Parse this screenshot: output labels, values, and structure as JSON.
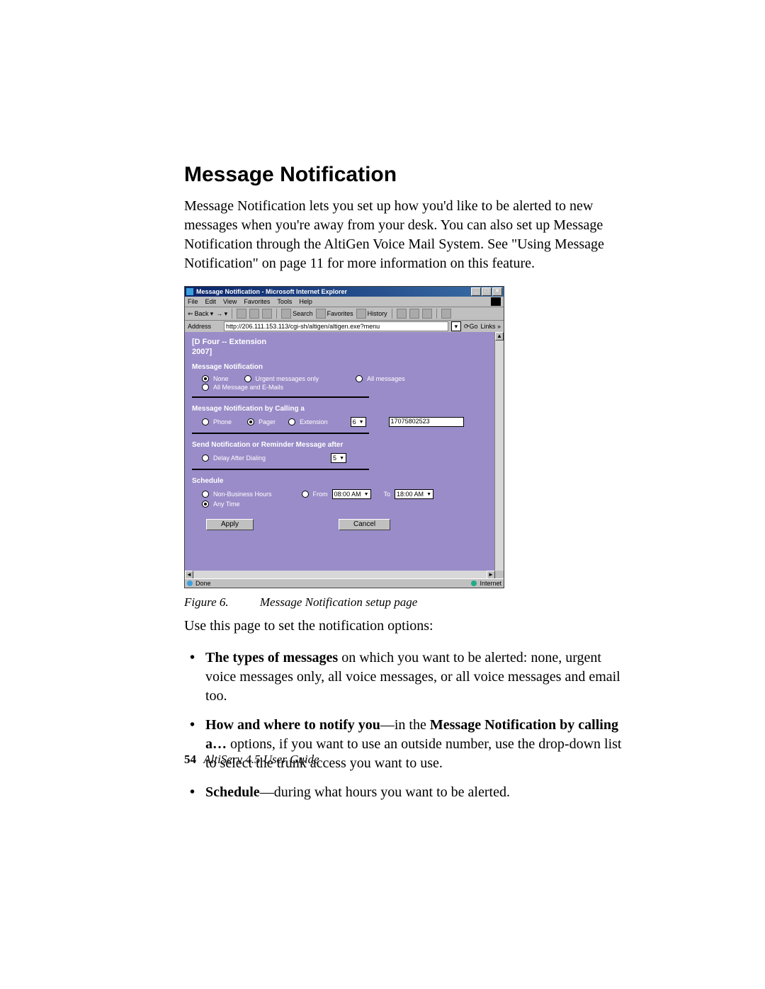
{
  "heading": "Message Notification",
  "intro": "Message Notification lets you set up how you'd like to be alerted to new messages when you're away from your desk. You can also set up Message Notification through the AltiGen Voice Mail System. See \"Using Message Notification\" on page 11 for more information on this feature.",
  "caption": {
    "label": "Figure 6.",
    "text": "Message Notification setup page"
  },
  "lead_out": "Use this page to set the notification options:",
  "bullets": [
    {
      "b": "The types of messages",
      "rest": " on which you want to be alerted: none, urgent voice messages only, all voice messages, or all voice messages and email too."
    },
    {
      "b": "How and where to notify you",
      "mid": "—in the ",
      "b2": "Message Notification by calling a…",
      "rest": " options, if you want to use an outside number, use the drop-down list to select the trunk access you want to use."
    },
    {
      "b": "Schedule",
      "rest": "—during what hours you want to be alerted."
    }
  ],
  "footer": {
    "page": "54",
    "guide": "AltiServ 4.5 User Guide"
  },
  "ie": {
    "title": "Message Notification - Microsoft Internet Explorer",
    "menus": [
      "File",
      "Edit",
      "View",
      "Favorites",
      "Tools",
      "Help"
    ],
    "toolbar": {
      "back": "Back",
      "search": "Search",
      "favorites": "Favorites",
      "history": "History"
    },
    "address_label": "Address",
    "address_value": "http://206.111.153.113/cgi-sh/altigen/altigen.exe?menu",
    "go": "Go",
    "links": "Links »",
    "status_done": "Done",
    "status_zone": "Internet"
  },
  "form": {
    "user_line1": "[D Four -- Extension",
    "user_line2": "2007]",
    "sec1": "Message Notification",
    "opt_none": "None",
    "opt_urgent": "Urgent messages only",
    "opt_all": "All messages",
    "opt_allmail": "All Message and E-Mails",
    "sec2": "Message Notification by Calling a",
    "opt_phone": "Phone",
    "opt_pager": "Pager",
    "opt_ext": "Extension",
    "trunk": "6",
    "number": "17075802523",
    "sec3": "Send Notification or Reminder Message after",
    "delay_label": "Delay After Dialing",
    "delay_value": "5",
    "sec4": "Schedule",
    "sched_nbh": "Non-Business Hours",
    "sched_from": "From",
    "sched_from_v": "08:00 AM",
    "sched_to": "To",
    "sched_to_v": "18:00 AM",
    "sched_any": "Any Time",
    "apply": "Apply",
    "cancel": "Cancel"
  }
}
